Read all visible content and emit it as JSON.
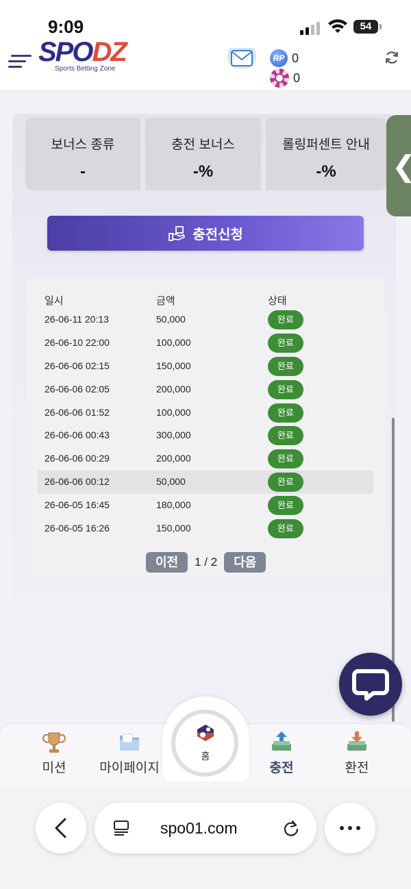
{
  "status_bar": {
    "time": "9:09",
    "battery": "54"
  },
  "header": {
    "logo_text_main": "SPO",
    "logo_text_accent": "DZ",
    "logo_subtitle": "Sports Betting Zone",
    "rp_badge": "RP",
    "rp_points": "0",
    "chip_points": "0"
  },
  "bonus_cards": [
    {
      "label": "보너스 종류",
      "value": "-"
    },
    {
      "label": "충전 보너스",
      "value": "-%"
    },
    {
      "label": "롤링퍼센트 안내",
      "value": "-%"
    }
  ],
  "side_tab": {
    "glyph": "❮"
  },
  "apply_button": {
    "label": "충전신청"
  },
  "table": {
    "headers": {
      "date": "일시",
      "amount": "금액",
      "status": "상태"
    },
    "rows": [
      {
        "date": "26-06-11 20:13",
        "amount": "50,000",
        "status": "완료"
      },
      {
        "date": "26-06-10 22:00",
        "amount": "100,000",
        "status": "완료"
      },
      {
        "date": "26-06-06 02:15",
        "amount": "150,000",
        "status": "완료"
      },
      {
        "date": "26-06-06 02:05",
        "amount": "200,000",
        "status": "완료"
      },
      {
        "date": "26-06-06 01:52",
        "amount": "100,000",
        "status": "완료"
      },
      {
        "date": "26-06-06 00:43",
        "amount": "300,000",
        "status": "완료"
      },
      {
        "date": "26-06-06 00:29",
        "amount": "200,000",
        "status": "완료"
      },
      {
        "date": "26-06-06 00:12",
        "amount": "50,000",
        "status": "완료"
      },
      {
        "date": "26-06-05 16:45",
        "amount": "180,000",
        "status": "완료"
      },
      {
        "date": "26-06-05 16:26",
        "amount": "150,000",
        "status": "완료"
      }
    ]
  },
  "pagination": {
    "prev": "이전",
    "info": "1 / 2",
    "next": "다음"
  },
  "bottom_nav": {
    "mission": "미션",
    "mypage": "마이페이지",
    "home": "홈",
    "deposit": "충전",
    "withdraw": "환전"
  },
  "browser": {
    "url": "spo01.com"
  },
  "colors": {
    "accent": "#5a4bc0",
    "status_done": "#3d8d37",
    "chat_button": "#2e2a63"
  }
}
